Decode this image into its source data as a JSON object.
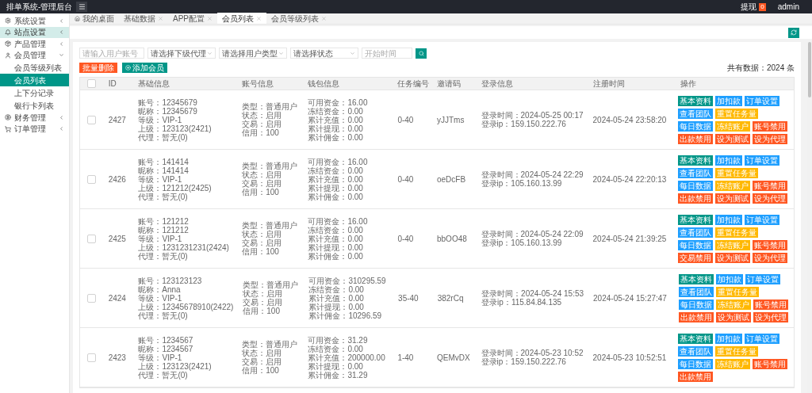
{
  "header": {
    "title": "排单系统-管理后台",
    "link": "提现",
    "badge": "0",
    "user": "admin"
  },
  "sidebar": {
    "items": [
      {
        "label": "系统设置",
        "selected": false,
        "expanded": false
      },
      {
        "label": "站点设置",
        "selected": true,
        "expanded": false
      },
      {
        "label": "产品管理",
        "selected": false,
        "expanded": false
      },
      {
        "label": "会员管理",
        "selected": false,
        "expanded": true,
        "children": [
          {
            "label": "会员等级列表",
            "selected": false
          },
          {
            "label": "会员列表",
            "selected": true
          },
          {
            "label": "上下分记录",
            "selected": false
          },
          {
            "label": "银行卡列表",
            "selected": false
          }
        ]
      },
      {
        "label": "财务管理",
        "selected": false,
        "expanded": false
      },
      {
        "label": "订单管理",
        "selected": false,
        "expanded": false
      }
    ]
  },
  "tabs": [
    {
      "label": "我的桌面",
      "selected": false,
      "kind": "home"
    },
    {
      "label": "基础数据",
      "selected": false,
      "kind": "closable"
    },
    {
      "label": "APP配置",
      "selected": false,
      "kind": "closable"
    },
    {
      "label": "会员列表",
      "selected": true,
      "kind": "closable"
    },
    {
      "label": "会员等级列表",
      "selected": false,
      "kind": "closable"
    }
  ],
  "filters": {
    "account": {
      "placeholder": "请输入用户账号"
    },
    "selects": [
      {
        "placeholder": "请选择下级代理"
      },
      {
        "placeholder": "请选择用户类型"
      },
      {
        "placeholder": "请选择状态"
      }
    ],
    "date": {
      "placeholder": "开始时间"
    }
  },
  "actions": [
    {
      "label": "批量删除",
      "color": "#ff5722",
      "kind": "plain"
    },
    {
      "label": "添加会员",
      "color": "#009688",
      "kind": "add"
    }
  ],
  "total": "共有数据：2024 条",
  "table": {
    "header_checked": false,
    "columns": [
      "ID",
      "基础信息",
      "账号信息",
      "钱包信息",
      "任务编号",
      "邀请码",
      "登录信息",
      "注册时间",
      "操作"
    ],
    "rows": [
      {
        "checked": false,
        "id": "2427",
        "basic": [
          "账号：12345679",
          "昵称：12345679",
          "等级：VIP-1",
          "上级：123123(2421)",
          "代理：暂无(0)"
        ],
        "account": [
          "类型：普通用户",
          "状态：启用",
          "交易：启用",
          "信用：100"
        ],
        "wallet": [
          "可用资金：16.00",
          "冻结资金：0.00",
          "累计充值：0.00",
          "累计提现：0.00",
          "累计佣金：0.00"
        ],
        "task": "0-40",
        "invite": "yJJTms",
        "login": [
          "登录时间：2024-05-25 00:17",
          "登录ip：159.150.222.76"
        ],
        "registered": "2024-05-24 23:58:20",
        "buttons": [
          {
            "label": "基本资料",
            "color": "#009688"
          },
          {
            "label": "加扣款",
            "color": "#1e9fff"
          },
          {
            "label": "订单设置",
            "color": "#1e9fff"
          },
          {
            "label": "查看团队",
            "color": "#1e9fff"
          },
          {
            "label": "重置任务量",
            "color": "#ffb800"
          },
          {
            "label": "每日数据",
            "color": "#1e9fff"
          },
          {
            "label": "冻结账户",
            "color": "#ffb800"
          },
          {
            "label": "账号禁用",
            "color": "#ff5722"
          },
          {
            "label": "出款禁用",
            "color": "#ff5722"
          },
          {
            "label": "设为测试",
            "color": "#ff5722"
          },
          {
            "label": "设为代理",
            "color": "#ff5722"
          }
        ]
      },
      {
        "checked": false,
        "id": "2426",
        "basic": [
          "账号：141414",
          "昵称：141414",
          "等级：VIP-1",
          "上级：121212(2425)",
          "代理：暂无(0)"
        ],
        "account": [
          "类型：普通用户",
          "状态：启用",
          "交易：启用",
          "信用：100"
        ],
        "wallet": [
          "可用资金：16.00",
          "冻结资金：0.00",
          "累计充值：0.00",
          "累计提现：0.00",
          "累计佣金：0.00"
        ],
        "task": "0-40",
        "invite": "oeDcFB",
        "login": [
          "登录时间：2024-05-24 22:29",
          "登录ip：105.160.13.99"
        ],
        "registered": "2024-05-24 22:20:13",
        "buttons": [
          {
            "label": "基本资料",
            "color": "#009688"
          },
          {
            "label": "加扣款",
            "color": "#1e9fff"
          },
          {
            "label": "订单设置",
            "color": "#1e9fff"
          },
          {
            "label": "查看团队",
            "color": "#1e9fff"
          },
          {
            "label": "重置任务量",
            "color": "#ffb800"
          },
          {
            "label": "每日数据",
            "color": "#1e9fff"
          },
          {
            "label": "冻结账户",
            "color": "#ffb800"
          },
          {
            "label": "账号禁用",
            "color": "#ff5722"
          },
          {
            "label": "出款禁用",
            "color": "#ff5722"
          },
          {
            "label": "设为测试",
            "color": "#ff5722"
          },
          {
            "label": "设为代理",
            "color": "#ff5722"
          }
        ]
      },
      {
        "checked": false,
        "id": "2425",
        "basic": [
          "账号：121212",
          "昵称：121212",
          "等级：VIP-1",
          "上级：1231231231(2424)",
          "代理：暂无(0)"
        ],
        "account": [
          "类型：普通用户",
          "状态：启用",
          "交易：启用",
          "信用：100"
        ],
        "wallet": [
          "可用资金：16.00",
          "冻结资金：0.00",
          "累计充值：0.00",
          "累计提现：0.00",
          "累计佣金：0.00"
        ],
        "task": "0-40",
        "invite": "bbOO48",
        "login": [
          "登录时间：2024-05-24 22:09",
          "登录ip：105.160.13.99"
        ],
        "registered": "2024-05-24 21:39:25",
        "buttons": [
          {
            "label": "基本资料",
            "color": "#009688"
          },
          {
            "label": "加扣款",
            "color": "#1e9fff"
          },
          {
            "label": "订单设置",
            "color": "#1e9fff"
          },
          {
            "label": "查看团队",
            "color": "#1e9fff"
          },
          {
            "label": "重置任务量",
            "color": "#ffb800"
          },
          {
            "label": "每日数据",
            "color": "#1e9fff"
          },
          {
            "label": "冻结账户",
            "color": "#ffb800"
          },
          {
            "label": "账号禁用",
            "color": "#ff5722"
          },
          {
            "label": "交易禁用",
            "color": "#ff5722"
          },
          {
            "label": "设为测试",
            "color": "#ff5722"
          },
          {
            "label": "设为代理",
            "color": "#ff5722"
          }
        ]
      },
      {
        "checked": false,
        "id": "2424",
        "basic": [
          "账号：123123123",
          "昵称：Anna",
          "等级：VIP-1",
          "上级：12345678910(2422)",
          "代理：暂无(0)"
        ],
        "account": [
          "类型：普通用户",
          "状态：启用",
          "交易：启用",
          "信用：100"
        ],
        "wallet": [
          "可用资金：310295.59",
          "冻结资金：0.00",
          "累计充值：0.00",
          "累计提现：0.00",
          "累计佣金：10296.59"
        ],
        "task": "35-40",
        "invite": "382rCq",
        "login": [
          "登录时间：2024-05-24 15:53",
          "登录ip：115.84.84.135"
        ],
        "registered": "2024-05-24 15:27:47",
        "buttons": [
          {
            "label": "基本资料",
            "color": "#009688"
          },
          {
            "label": "加扣款",
            "color": "#1e9fff"
          },
          {
            "label": "订单设置",
            "color": "#1e9fff"
          },
          {
            "label": "查看团队",
            "color": "#1e9fff"
          },
          {
            "label": "重置任务量",
            "color": "#ffb800"
          },
          {
            "label": "每日数据",
            "color": "#1e9fff"
          },
          {
            "label": "冻结账户",
            "color": "#ffb800"
          },
          {
            "label": "账号禁用",
            "color": "#ff5722"
          },
          {
            "label": "出款禁用",
            "color": "#ff5722"
          },
          {
            "label": "设为测试",
            "color": "#ff5722"
          },
          {
            "label": "设为代理",
            "color": "#ff5722"
          }
        ]
      },
      {
        "checked": false,
        "id": "2423",
        "basic": [
          "账号：1234567",
          "昵称：1234567",
          "等级：VIP-1",
          "上级：123123(2421)",
          "代理：暂无(0)"
        ],
        "account": [
          "类型：普通用户",
          "状态：启用",
          "交易：启用",
          "信用：100"
        ],
        "wallet": [
          "可用资金：31.29",
          "冻结资金：0.00",
          "累计充值：200000.00",
          "累计提现：0.00",
          "累计佣金：31.29"
        ],
        "task": "1-40",
        "invite": "QEMvDX",
        "login": [
          "登录时间：2024-05-23 10:52",
          "登录ip：159.150.222.76"
        ],
        "registered": "2024-05-23 10:52:51",
        "buttons": [
          {
            "label": "基本资料",
            "color": "#009688"
          },
          {
            "label": "加扣款",
            "color": "#1e9fff"
          },
          {
            "label": "订单设置",
            "color": "#1e9fff"
          },
          {
            "label": "查看团队",
            "color": "#1e9fff"
          },
          {
            "label": "重置任务量",
            "color": "#ffb800"
          },
          {
            "label": "每日数据",
            "color": "#1e9fff"
          },
          {
            "label": "冻结账户",
            "color": "#ffb800"
          },
          {
            "label": "账号禁用",
            "color": "#ff5722"
          },
          {
            "label": "出款禁用",
            "color": "#ff5722"
          }
        ]
      }
    ]
  }
}
